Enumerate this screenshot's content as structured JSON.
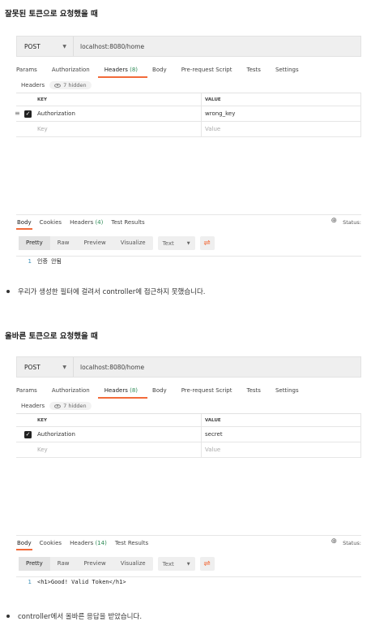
{
  "sections": [
    {
      "heading": "잘못된 토큰으로 요청했을 때",
      "method": "POST",
      "url": "localhost:8080/home",
      "tabs": [
        "Params",
        "Authorization",
        "Headers",
        "(8)",
        "Body",
        "Pre-request Script",
        "Tests",
        "Settings"
      ],
      "headers_label": "Headers",
      "hidden_label": "7 hidden",
      "col_key": "KEY",
      "col_value": "VALUE",
      "row_key": "Authorization",
      "row_value": "wrong_key",
      "placeholder_key": "Key",
      "placeholder_value": "Value",
      "resp_tabs": [
        "Body",
        "Cookies",
        "Headers",
        "(4)",
        "Test Results"
      ],
      "status_label": "Status:",
      "view_buttons": [
        "Pretty",
        "Raw",
        "Preview",
        "Visualize"
      ],
      "format": "Text",
      "line_no": "1",
      "code": "인증 안됨",
      "bullet": "우리가 생성한 필터에 걸려서 controller에 접근하지 못했습니다."
    },
    {
      "heading": "올바른 토큰으로 요청했을 때",
      "method": "POST",
      "url": "localhost:8080/home",
      "tabs": [
        "Params",
        "Authorization",
        "Headers",
        "(8)",
        "Body",
        "Pre-request Script",
        "Tests",
        "Settings"
      ],
      "headers_label": "Headers",
      "hidden_label": "7 hidden",
      "col_key": "KEY",
      "col_value": "VALUE",
      "row_key": "Authorization",
      "row_value": "secret",
      "placeholder_key": "Key",
      "placeholder_value": "Value",
      "resp_tabs": [
        "Body",
        "Cookies",
        "Headers",
        "(14)",
        "Test Results"
      ],
      "status_label": "Status:",
      "view_buttons": [
        "Pretty",
        "Raw",
        "Preview",
        "Visualize"
      ],
      "format": "Text",
      "line_no": "1",
      "code": "<h1>Good! Valid Token</h1>",
      "bullet": "controller에서 올바른 응답을 받았습니다."
    }
  ],
  "colors": {
    "accent": "#f26b3a",
    "count": "#2e8b57",
    "line_no": "#3a8fb7"
  },
  "icons": [
    "chevron-down-icon",
    "eye-icon",
    "check-icon",
    "drag-handle-icon",
    "globe-icon",
    "wrap-lines-icon"
  ]
}
